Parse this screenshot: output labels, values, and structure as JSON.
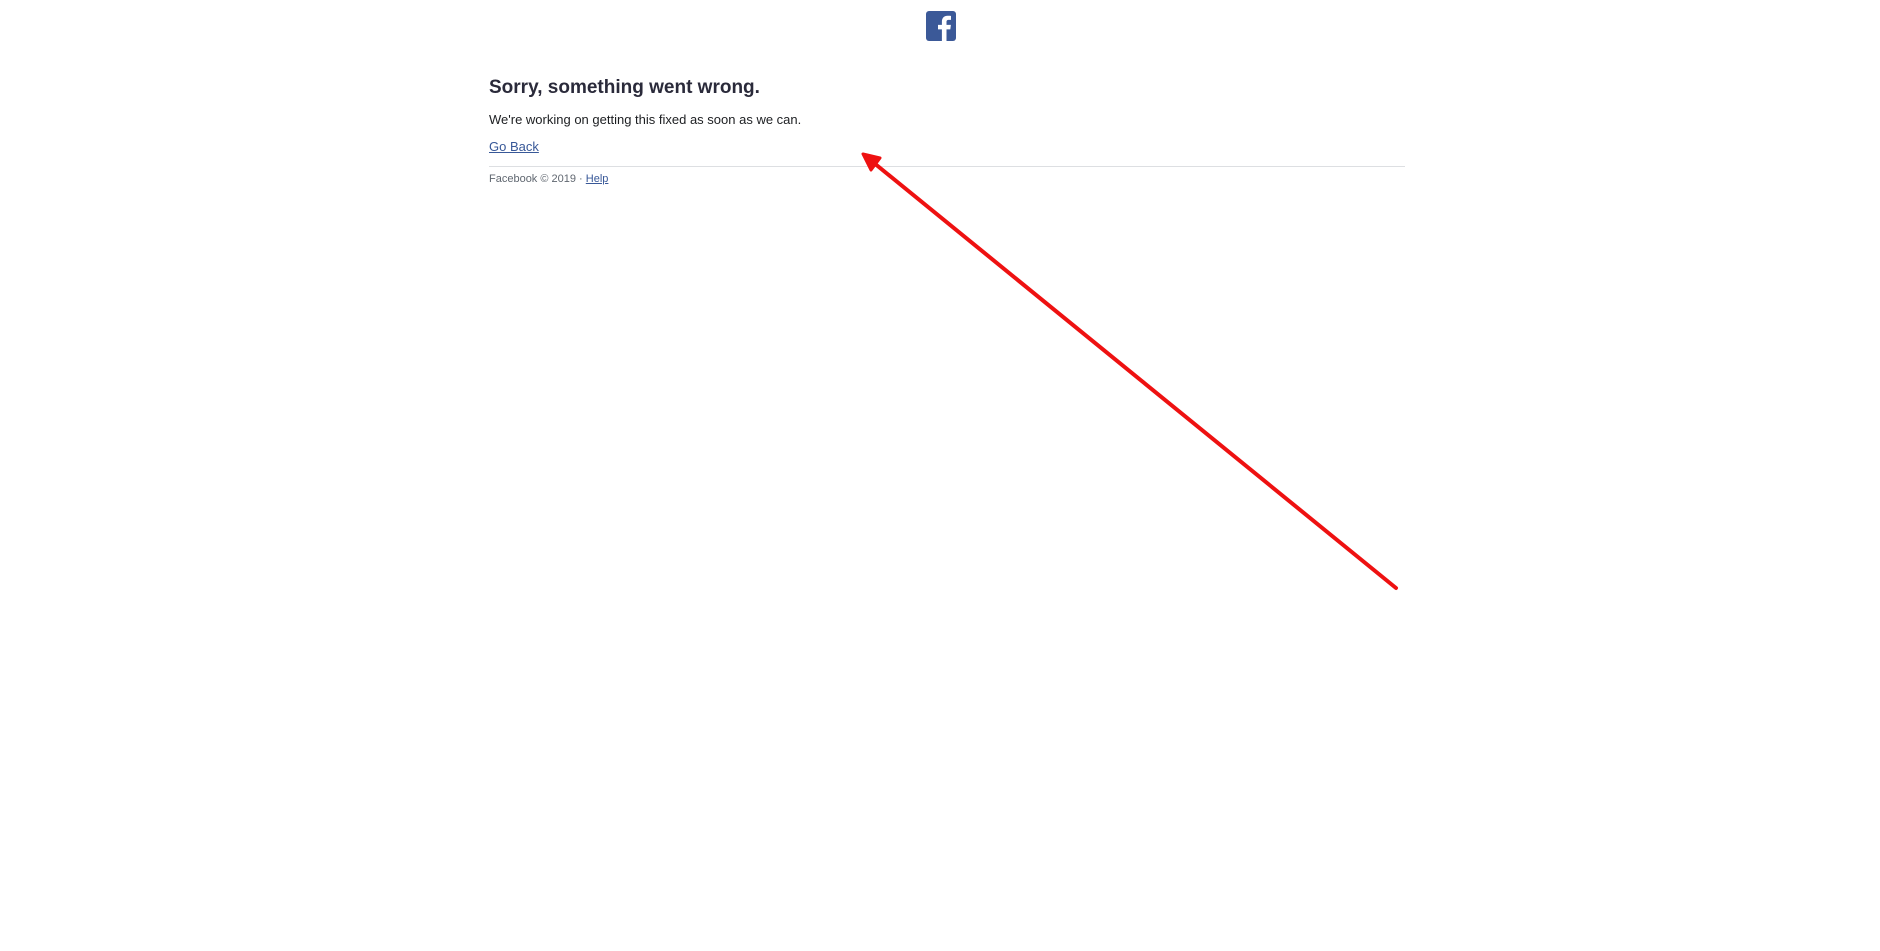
{
  "brand": {
    "logo_icon": "facebook-f-icon",
    "logo_color": "#3b5998"
  },
  "error": {
    "title": "Sorry, something went wrong.",
    "message": "We're working on getting this fixed as soon as we can.",
    "go_back_label": "Go Back"
  },
  "footer": {
    "copyright": "Facebook © 2019 · ",
    "help_label": "Help"
  },
  "annotation": {
    "icon": "red-arrow-annotation",
    "color": "#ee1111"
  },
  "colors": {
    "link": "#385898",
    "divider": "#dddfe2",
    "footer_text": "#606770"
  }
}
